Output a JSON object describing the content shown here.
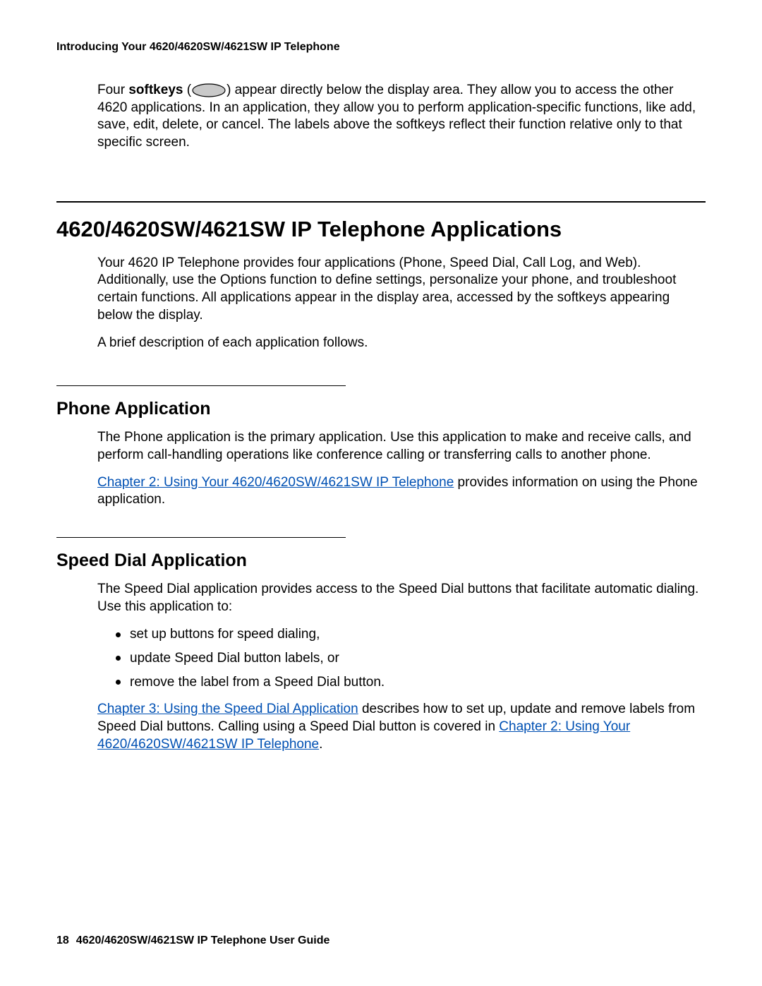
{
  "header": {
    "running_head": "Introducing Your 4620/4620SW/4621SW IP Telephone"
  },
  "intro_paragraph": {
    "lead_a": "Four ",
    "bold": "softkeys",
    "lead_b": " (",
    "after_icon": ") appear directly below the display area. They allow you to access the other 4620 applications. In an application, they allow you to perform application-specific functions, like add, save, edit, delete, or cancel. The labels above the softkeys reflect their function relative only to that specific screen."
  },
  "section": {
    "title": "4620/4620SW/4621SW IP Telephone Applications",
    "para1": "Your 4620 IP Telephone provides four applications (Phone, Speed Dial, Call Log, and Web). Additionally, use the Options function to define settings, personalize your phone, and troubleshoot certain functions. All applications appear in the display area, accessed by the softkeys appearing below the display.",
    "para2": "A brief description of each application follows."
  },
  "phone": {
    "title": "Phone Application",
    "para1": "The Phone application is the primary application. Use this application to make and receive calls, and perform call-handling operations like conference calling or transferring calls to another phone.",
    "link": "Chapter 2: Using Your 4620/4620SW/4621SW IP Telephone",
    "para2_tail": " provides information on using the Phone application."
  },
  "speed": {
    "title": "Speed Dial Application",
    "para1": "The Speed Dial application provides access to the Speed Dial buttons that facilitate automatic dialing. Use this application to:",
    "bullets": [
      "set up buttons for speed dialing,",
      "update Speed Dial button labels, or",
      "remove the label from a Speed Dial button."
    ],
    "link1": "Chapter 3: Using the Speed Dial Application",
    "para2_mid": " describes how to set up, update and remove labels from Speed Dial buttons. Calling using a Speed Dial button is covered in ",
    "link2": "Chapter 2: Using Your 4620/4620SW/4621SW IP Telephone",
    "para2_tail": "."
  },
  "footer": {
    "page_number": "18",
    "guide_title": "4620/4620SW/4621SW IP Telephone User Guide"
  }
}
